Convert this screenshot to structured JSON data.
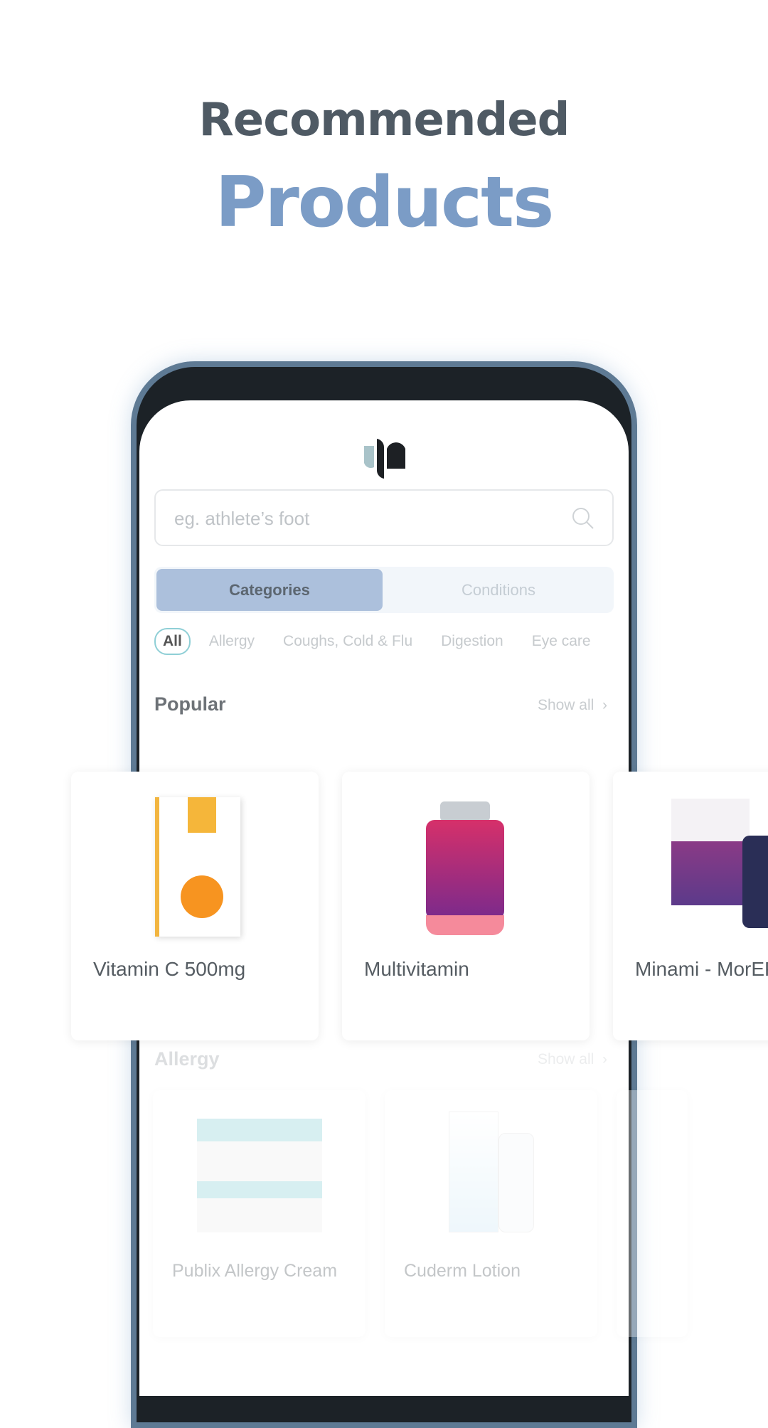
{
  "headline": {
    "line1": "Recommended",
    "line2": "Products"
  },
  "app": {
    "logo": "pharmacy-logo",
    "search": {
      "placeholder": "eg. athlete’s foot",
      "icon": "search-icon"
    },
    "tabs": [
      {
        "label": "Categories",
        "active": true
      },
      {
        "label": "Conditions",
        "active": false
      }
    ],
    "chips": [
      {
        "label": "All",
        "active": true
      },
      {
        "label": "Allergy"
      },
      {
        "label": "Coughs, Cold & Flu"
      },
      {
        "label": "Digestion"
      },
      {
        "label": "Eye care"
      }
    ],
    "popular": {
      "title": "Popular",
      "show_all": "Show all",
      "products": [
        {
          "name": "Vitamin C 500mg"
        },
        {
          "name": "Multivitamin"
        },
        {
          "name": "Minami - MorEPA"
        }
      ]
    },
    "allergy": {
      "title": "Allergy",
      "show_all": "Show all",
      "products": [
        {
          "name": "Publix Allergy Cream"
        },
        {
          "name": "Cuderm Lotion"
        }
      ]
    }
  },
  "colors": {
    "headline_dark": "#4f5a64",
    "headline_accent": "#7b9cc6",
    "tab_active": "#acc0dc",
    "phone_frame": "#5e7a94"
  }
}
